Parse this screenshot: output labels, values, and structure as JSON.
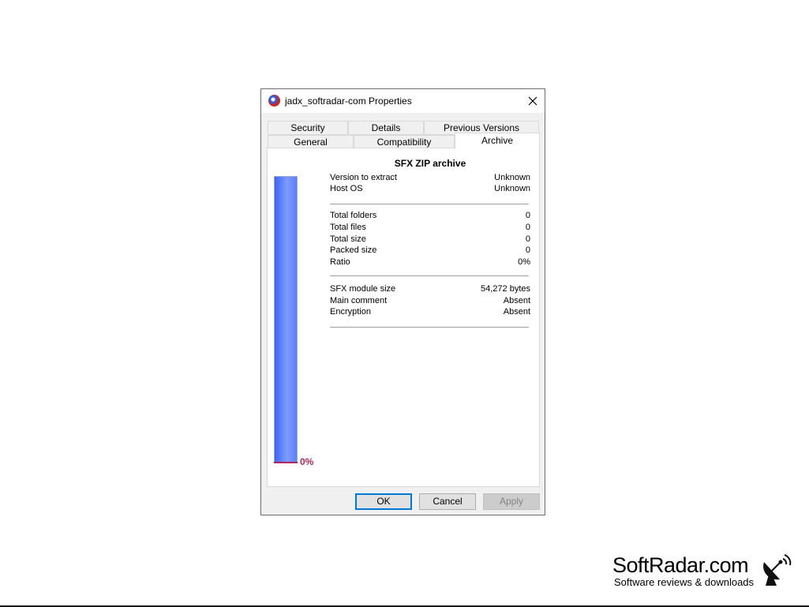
{
  "window": {
    "title": "jadx_softradar-com Properties"
  },
  "tabs": {
    "row1": [
      "Security",
      "Details",
      "Previous Versions"
    ],
    "row2": [
      "General",
      "Compatibility",
      "Archive"
    ],
    "active": "Archive"
  },
  "archive": {
    "title": "SFX ZIP archive",
    "ratio_bar": {
      "fill_fraction": 0.0,
      "label": "0%"
    },
    "group1": [
      {
        "label": "Version to extract",
        "value": "Unknown"
      },
      {
        "label": "Host OS",
        "value": "Unknown"
      }
    ],
    "group2": [
      {
        "label": "Total folders",
        "value": "0"
      },
      {
        "label": "Total files",
        "value": "0"
      },
      {
        "label": "Total size",
        "value": "0"
      },
      {
        "label": "Packed size",
        "value": "0"
      },
      {
        "label": "Ratio",
        "value": "0%"
      }
    ],
    "group3": [
      {
        "label": "SFX module size",
        "value": "54,272 bytes"
      },
      {
        "label": "Main comment",
        "value": "Absent"
      },
      {
        "label": "Encryption",
        "value": "Absent"
      }
    ]
  },
  "buttons": {
    "ok": "OK",
    "cancel": "Cancel",
    "apply": "Apply"
  },
  "watermark": {
    "name": "SoftRadar.com",
    "tagline": "Software reviews & downloads"
  },
  "icons": {
    "app": "archive-app-icon",
    "close": "close-icon",
    "brand": "satellite-dish-icon"
  },
  "colors": {
    "ratio_bar": "#5d80fb",
    "ratio_label": "#b0255d",
    "default_button_border": "#0078d7"
  }
}
